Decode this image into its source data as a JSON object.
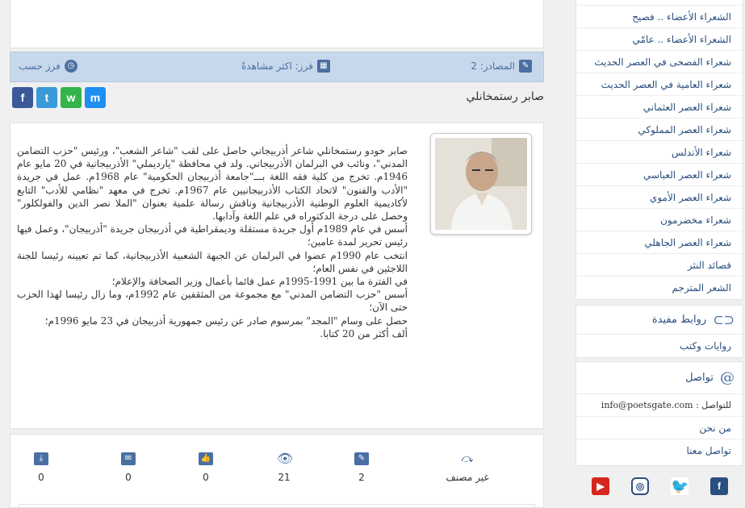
{
  "info_bar": {
    "sources_label": "المصادر: 2",
    "sort_label": "فرز: اكثر مشاهدةً",
    "sort_by_label": "فرز حسب"
  },
  "share": {
    "facebook": "f",
    "twitter": "t",
    "whatsapp": "w",
    "messenger": "m"
  },
  "poet": {
    "name": "صابر رستمخانلي",
    "bio": [
      "صابر خودو رستمخانلي شاعر أذربيجاني حاصل على لقب \"شاعر الشعب\"، ورئيس \"حزب التضامن المدني\"، ونائب في البرلمان الأذربيجاني. ولد في محافظة \"يارديملي\" الأذربيجانية في 20 مايو عام 1946م. تخرج من كلية فقه اللغة بـــ\"جامعة أذربيجان الحكومية\" عام 1968م. عمل في جريدة \"الأدب والفنون\" لاتحاد الكتاب الأذربيجانيين عام 1967م. تخرج في معهد \"نظامي للأدب\" التابع لأكاديمية العلوم الوطنية الأذربيجانية وناقش رسالة علمية بعنوان \"الملا نصر الدين والفولكلور\" وحصل على درجة الدكتوراه في علم اللغة وآدابها.",
      "أسس في عام 1989م أول جريدة مستقلة وديمقراطية في أذربيجان جريدة \"أذربيجان\"، وعمل فيها رئيس تحرير لمدة عامين؛",
      "انتخب عام 1990م عضوا في البرلمان عن الجبهة الشعبية الأذربيجانية، كما تم تعيينه رئيسا للجنة اللاجئين في نفس العام؛",
      "في الفترة ما بين 1991-1995م عمل قائما بأعمال وزير الصحافة والإعلام؛",
      "أسس \"حزب التضامن المدني\" مع مجموعة من المثقفين عام 1992م، وما زال رئيسا لهذا الحزب حتى الآن؛",
      "حصل على وسام \"المجد\" بمرسوم صادر عن رئيس جمهورية أذربيجان في 23 مايو 1996م؛",
      "ألف أكثر من 20 كتابا."
    ]
  },
  "stats": {
    "downloads": "0",
    "comments": "0",
    "likes": "0",
    "views": "21",
    "sources": "2",
    "category": "غير مصنف"
  },
  "sidebar": {
    "categories": [
      "الشعراء الأعضاء .. فصيح",
      "الشعراء الأعضاء .. عامّي",
      "شعراء الفصحى في العصر الحديث",
      "شعراء العامية في العصر الحديث",
      "شعراء العصر العثماني",
      "شعراء العصر المملوكي",
      "شعراء الأندلس",
      "شعراء العصر العباسي",
      "شعراء العصر الأموي",
      "شعراء مخضرمون",
      "شعراء العصر الجاهلي",
      "قصائد النثر",
      "الشعر المترجم"
    ],
    "links_title": "روابط مفيدة",
    "links": [
      "روايات وكتب"
    ],
    "contact_title": "تواصل",
    "contact_email_line": "للتواصل : info@poetsgate.com",
    "about_label": "من نحن",
    "contact_us_label": "تواصل معنا"
  },
  "colors": {
    "accent": "#4a6fa3",
    "bar_bg": "#c8d8ec",
    "link": "#2a4f7e"
  }
}
